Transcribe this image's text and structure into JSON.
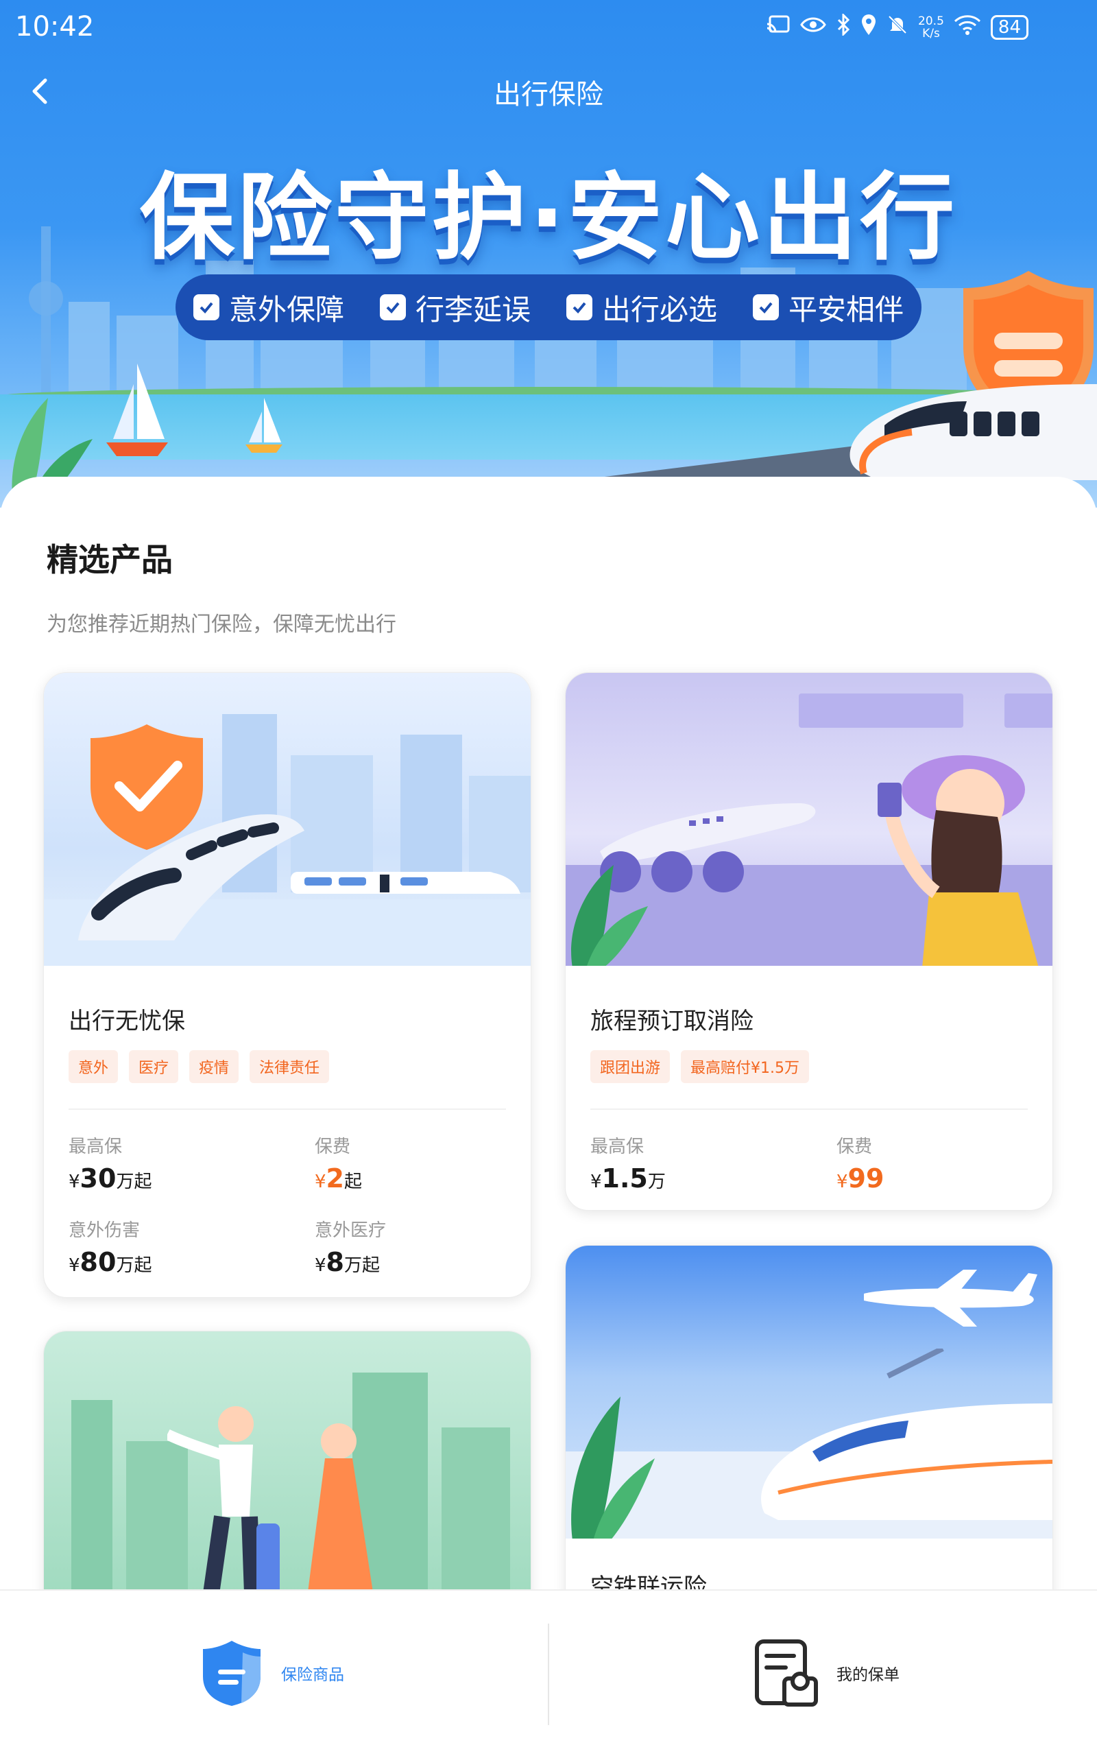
{
  "status_bar": {
    "time": "10:42",
    "net_speed_value": "20.5",
    "net_speed_unit": "K/s",
    "battery": "84"
  },
  "nav": {
    "title": "出行保险"
  },
  "hero": {
    "slogan": "保险守护·安心出行",
    "features": [
      "意外保障",
      "行李延误",
      "出行必选",
      "平安相伴"
    ]
  },
  "section": {
    "title": "精选产品",
    "subtitle": "为您推荐近期热门保险，保障无忧出行"
  },
  "products": [
    {
      "name": "出行无忧保",
      "tags": [
        "意外",
        "医疗",
        "疫情",
        "法律责任"
      ],
      "stats": [
        {
          "label": "最高保",
          "currency": "¥",
          "amount": "30",
          "unit": "万起"
        },
        {
          "label": "保费",
          "currency": "¥",
          "amount": "2",
          "unit": "起"
        },
        {
          "label": "意外伤害",
          "currency": "¥",
          "amount": "80",
          "unit": "万起"
        },
        {
          "label": "意外医疗",
          "currency": "¥",
          "amount": "8",
          "unit": "万起"
        }
      ]
    },
    {
      "name": "旅程预订取消险",
      "tags": [
        "跟团出游",
        "最高赔付¥1.5万"
      ],
      "stats": [
        {
          "label": "最高保",
          "currency": "¥",
          "amount": "1.5",
          "unit": "万"
        },
        {
          "label": "保费",
          "currency": "¥",
          "amount": "99",
          "unit": ""
        }
      ]
    },
    {
      "name": ""
    },
    {
      "name": "空铁联运险"
    }
  ],
  "tabbar": {
    "tabs": [
      {
        "label": "保险商品",
        "active": true
      },
      {
        "label": "我的保单",
        "active": false
      }
    ]
  },
  "colors": {
    "primary": "#2d8cf0",
    "accent_orange": "#f26a1e",
    "pill": "#1b4fb3"
  }
}
